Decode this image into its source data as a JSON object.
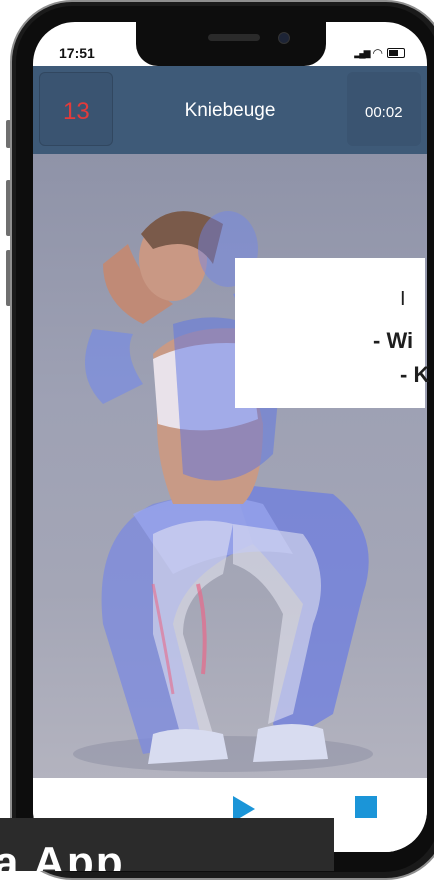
{
  "status_bar": {
    "time": "17:51",
    "signal": "▂▄▆",
    "wifi": "◠"
  },
  "header": {
    "counter": "13",
    "exercise": "Kniebeuge",
    "timer": "00:02"
  },
  "overlay": {
    "line1": "I",
    "line2": "- Wi",
    "line3": "- K"
  },
  "controls": {
    "play_label": "play",
    "stop_label": "stop"
  },
  "banner": {
    "text": "a App"
  },
  "colors": {
    "header_bg": "#3e5a78",
    "counter_text": "#e23b3b",
    "accent": "#1b95d8"
  },
  "icons": [
    "signal-icon",
    "wifi-icon",
    "battery-icon",
    "play-icon",
    "stop-icon",
    "circle-icon"
  ]
}
